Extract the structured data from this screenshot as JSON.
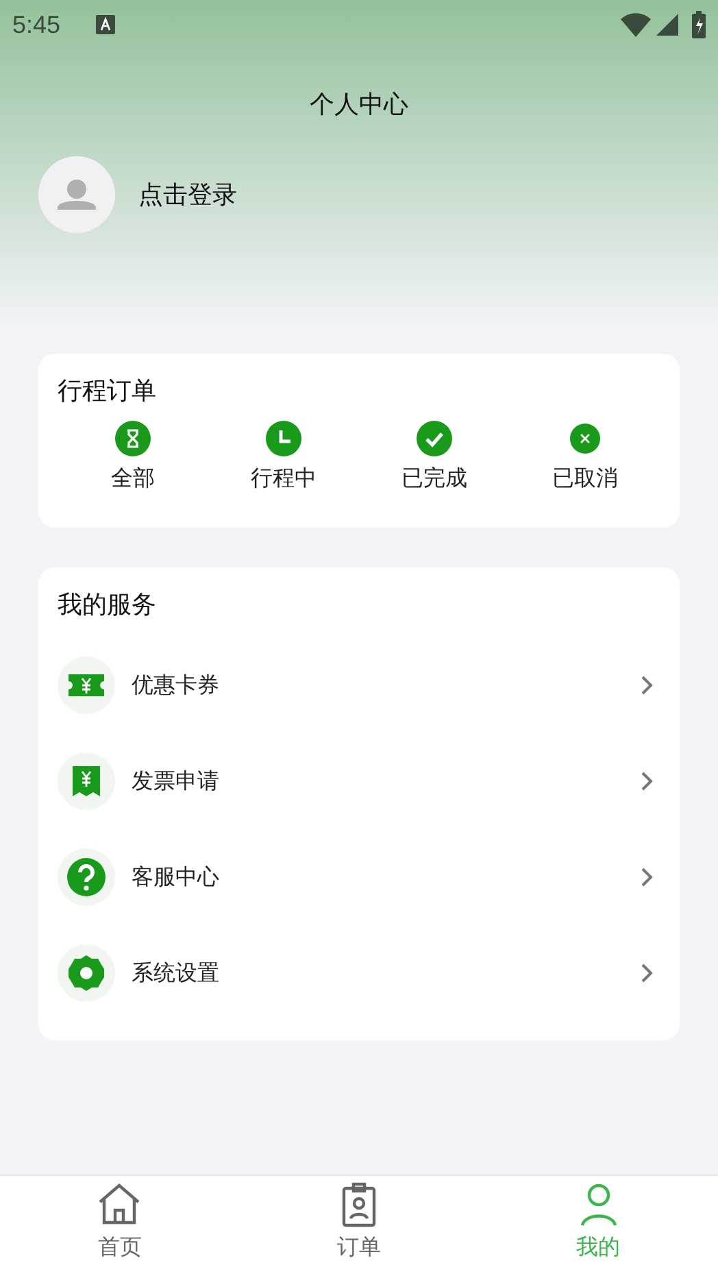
{
  "status_bar": {
    "time": "5:45"
  },
  "header": {
    "title": "个人中心"
  },
  "profile": {
    "login_label": "点击登录"
  },
  "trip_orders": {
    "title": "行程订单",
    "items": [
      {
        "label": "全部",
        "kind": "hourglass"
      },
      {
        "label": "行程中",
        "kind": "clock"
      },
      {
        "label": "已完成",
        "kind": "check"
      },
      {
        "label": "已取消",
        "kind": "cancel"
      }
    ]
  },
  "services": {
    "title": "我的服务",
    "items": [
      {
        "label": "优惠卡券",
        "kind": "coupon"
      },
      {
        "label": "发票申请",
        "kind": "invoice"
      },
      {
        "label": "客服中心",
        "kind": "help"
      },
      {
        "label": "系统设置",
        "kind": "settings"
      }
    ]
  },
  "tab_bar": [
    {
      "label": "首页",
      "kind": "home",
      "selected": false
    },
    {
      "label": "订单",
      "kind": "orders",
      "selected": false
    },
    {
      "label": "我的",
      "kind": "me",
      "selected": true
    }
  ]
}
